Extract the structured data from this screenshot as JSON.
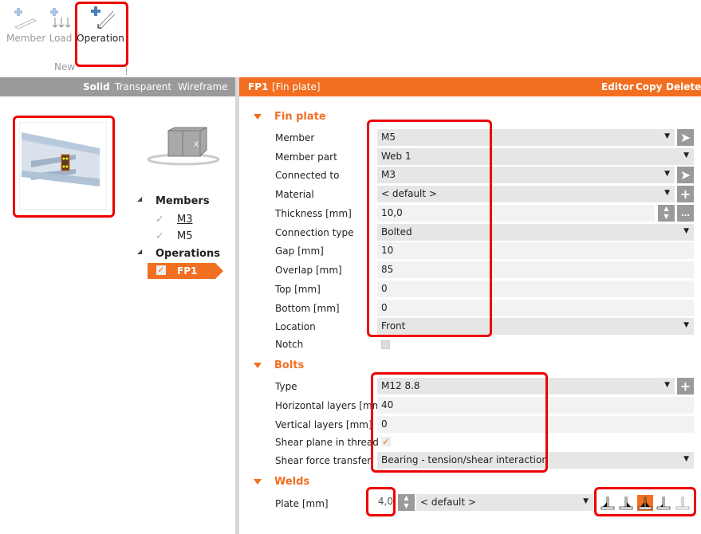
{
  "toolbar": {
    "member": "Member",
    "load": "Load",
    "operation": "Operation",
    "group": "New"
  },
  "view_bar": {
    "solid": "Solid",
    "transparent": "Transparent",
    "wireframe": "Wireframe"
  },
  "tree": {
    "members": "Members",
    "m3": "M3",
    "m5": "M5",
    "operations": "Operations",
    "fp1": "FP1"
  },
  "header": {
    "id": "FP1",
    "type": "[Fin plate]",
    "editor": "Editor",
    "copy": "Copy",
    "delete": "Delete"
  },
  "fin_plate": {
    "title": "Fin plate",
    "rows": [
      {
        "label": "Member",
        "value": "M5"
      },
      {
        "label": "Member part",
        "value": "Web 1"
      },
      {
        "label": "Connected to",
        "value": "M3"
      },
      {
        "label": "Material",
        "value": "< default >"
      },
      {
        "label": "Thickness [mm]",
        "value": "10,0"
      },
      {
        "label": "Connection type",
        "value": "Bolted"
      },
      {
        "label": "Gap [mm]",
        "value": "10"
      },
      {
        "label": "Overlap [mm]",
        "value": "85"
      },
      {
        "label": "Top [mm]",
        "value": "0"
      },
      {
        "label": "Bottom [mm]",
        "value": "0"
      },
      {
        "label": "Location",
        "value": "Front"
      },
      {
        "label": "Notch",
        "value": ""
      }
    ]
  },
  "bolts": {
    "title": "Bolts",
    "rows": [
      {
        "label": "Type",
        "value": "M12 8.8"
      },
      {
        "label": "Horizontal layers [mm]",
        "value": "40"
      },
      {
        "label": "Vertical layers [mm]",
        "value": "0"
      },
      {
        "label": "Shear plane in thread",
        "value": ""
      },
      {
        "label": "Shear force transfer",
        "value": "Bearing - tension/shear interaction"
      }
    ]
  },
  "welds": {
    "title": "Welds",
    "plate_label": "Plate [mm]",
    "plate_value": "4,0",
    "material": "< default >",
    "selected_weld_type": 3
  },
  "colors": {
    "accent": "#f26f22",
    "highlight": "#e00000"
  }
}
